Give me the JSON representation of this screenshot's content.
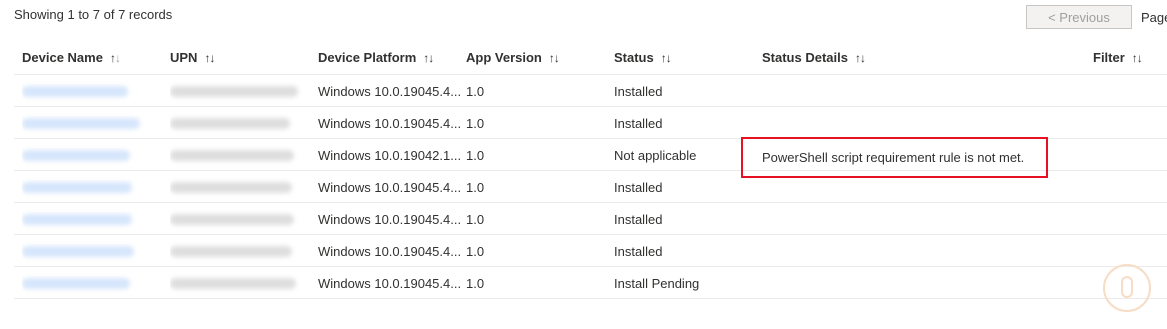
{
  "summary": {
    "records_text": "Showing 1 to 7 of 7 records"
  },
  "pager": {
    "previous_label": "< Previous",
    "page_label": "Page"
  },
  "columns": [
    {
      "label": "Device Name",
      "sort": "↑↓"
    },
    {
      "label": "UPN",
      "sort": "↑↓"
    },
    {
      "label": "Device Platform",
      "sort": "↑↓"
    },
    {
      "label": "App Version",
      "sort": "↑↓"
    },
    {
      "label": "Status",
      "sort": "↑↓"
    },
    {
      "label": "Status Details",
      "sort": "↑↓"
    },
    {
      "label": "Filter",
      "sort": "↑↓"
    }
  ],
  "rows": [
    {
      "platform": "Windows 10.0.19045.4...",
      "app_version": "1.0",
      "status": "Installed",
      "status_details": ""
    },
    {
      "platform": "Windows 10.0.19045.4...",
      "app_version": "1.0",
      "status": "Installed",
      "status_details": ""
    },
    {
      "platform": "Windows 10.0.19042.1...",
      "app_version": "1.0",
      "status": "Not applicable",
      "status_details": "PowerShell script requirement rule is not met."
    },
    {
      "platform": "Windows 10.0.19045.4...",
      "app_version": "1.0",
      "status": "Installed",
      "status_details": ""
    },
    {
      "platform": "Windows 10.0.19045.4...",
      "app_version": "1.0",
      "status": "Installed",
      "status_details": ""
    },
    {
      "platform": "Windows 10.0.19045.4...",
      "app_version": "1.0",
      "status": "Installed",
      "status_details": ""
    },
    {
      "platform": "Windows 10.0.19045.4...",
      "app_version": "1.0",
      "status": "Install Pending",
      "status_details": ""
    }
  ],
  "colors": {
    "link_redacted": "#d6e6fb",
    "text_redacted": "#dedede",
    "highlight": "#e81123",
    "divider": "#edebe9"
  },
  "icons": {
    "sort": "sort-arrows-icon",
    "watermark": "mouse-watermark-icon"
  }
}
